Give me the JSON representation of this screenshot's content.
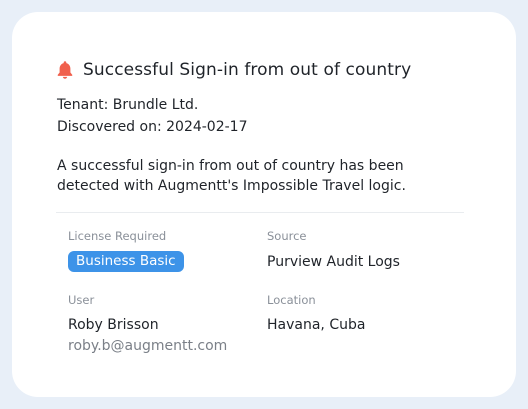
{
  "alert": {
    "title": "Successful Sign-in from out of country",
    "icon": "bell-icon",
    "icon_color": "#f0604d",
    "tenant": "Tenant: Brundle Ltd.",
    "discovered": "Discovered on: 2024-02-17",
    "description_line1": "A successful sign-in from out of country has been",
    "description_line2": "detected with Augmentt's Impossible Travel logic."
  },
  "details": {
    "license_label": "License Required",
    "license_value": "Business Basic",
    "license_badge_color": "#3d93e8",
    "source_label": "Source",
    "source_value": "Purview Audit Logs",
    "user_label": "User",
    "user_name": "Roby Brisson",
    "user_email": "roby.b@augmentt.com",
    "location_label": "Location",
    "location_value": "Havana, Cuba"
  }
}
